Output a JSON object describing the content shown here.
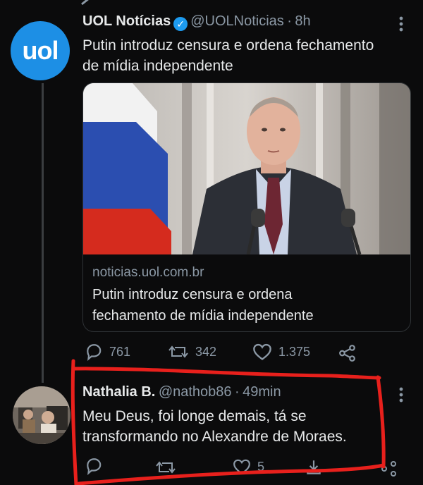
{
  "tweet": {
    "author_name": "UOL Notícias",
    "author_handle": "@UOLNoticias",
    "separator": "·",
    "time": "8h",
    "avatar_text": "uol",
    "text_line1": "Putin introduz censura e ordena fechamento",
    "text_line2": "de mídia independente",
    "card": {
      "domain": "noticias.uol.com.br",
      "title_line1": "Putin introduz censura e ordena",
      "title_line2": "fechamento de mídia independente"
    },
    "actions": {
      "replies": "761",
      "retweets": "342",
      "likes": "1.375"
    }
  },
  "reply": {
    "author_name": "Nathalia B.",
    "author_handle": "@nathob86",
    "separator": "·",
    "time": "49min",
    "text_line1": "Meu Deus, foi longe demais, tá se",
    "text_line2": "transformando no Alexandre de Moraes.",
    "actions": {
      "likes": "5"
    }
  },
  "colors": {
    "background": "#0b0b0c",
    "text": "#e7e9ea",
    "muted": "#8b98a5",
    "uol_blue": "#1d8fe5",
    "verified": "#1d9bf0",
    "annotation_red": "#e8201c"
  },
  "icons": [
    "retweet-context-icon",
    "more-icon",
    "verified-badge-icon",
    "reply-icon",
    "retweet-icon",
    "like-icon",
    "share-icon"
  ]
}
